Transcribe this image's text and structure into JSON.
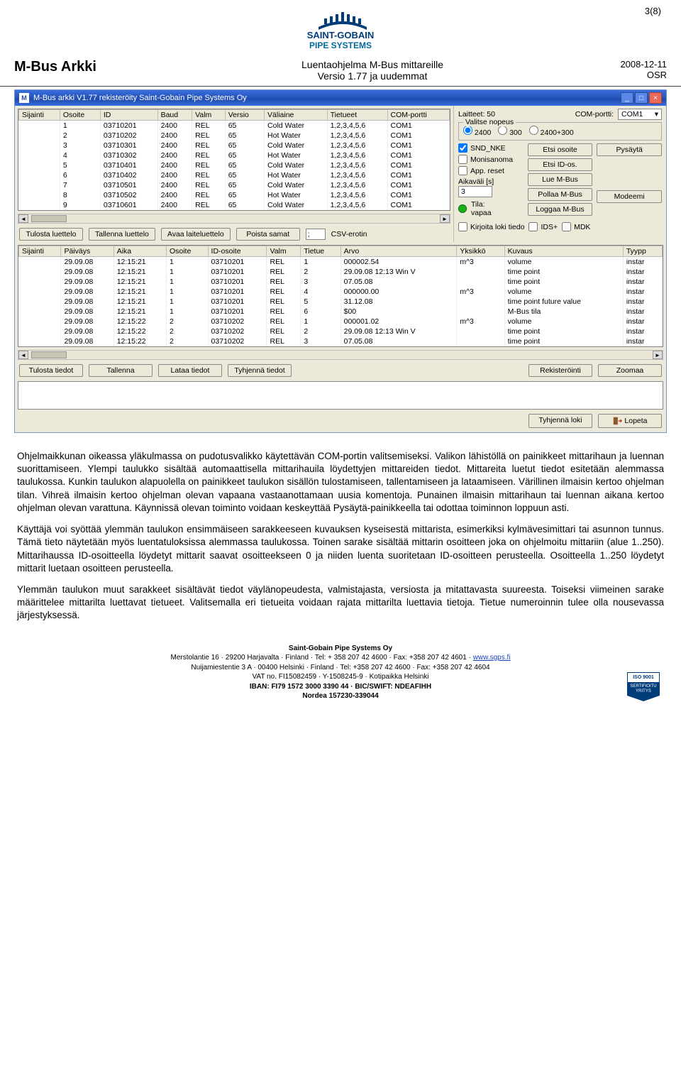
{
  "page": {
    "page_indicator": "3(8)",
    "product": "M-Bus Arkki",
    "subtitle_line1": "Luentaohjelma M-Bus mittareille",
    "subtitle_line2": "Versio 1.77 ja uudemmat",
    "date": "2008-12-11",
    "author": "OSR",
    "logo_brand": "SAINT-GOBAIN",
    "logo_sub": "PIPE SYSTEMS"
  },
  "window": {
    "title": "M-Bus arkki V1.77 rekisteröity  Saint-Gobain Pipe Systems Oy",
    "buttons": {
      "min": "_",
      "max": "□",
      "close": "×"
    },
    "table1": {
      "headers": [
        "Sijainti",
        "Osoite",
        "ID",
        "Baud",
        "Valm",
        "Versio",
        "Väliaine",
        "Tietueet",
        "COM-portti"
      ],
      "rows": [
        [
          "",
          "1",
          "03710201",
          "2400",
          "REL",
          "65",
          "Cold Water",
          "1,2,3,4,5,6",
          "COM1"
        ],
        [
          "",
          "2",
          "03710202",
          "2400",
          "REL",
          "65",
          "Hot Water",
          "1,2,3,4,5,6",
          "COM1"
        ],
        [
          "",
          "3",
          "03710301",
          "2400",
          "REL",
          "65",
          "Cold Water",
          "1,2,3,4,5,6",
          "COM1"
        ],
        [
          "",
          "4",
          "03710302",
          "2400",
          "REL",
          "65",
          "Hot Water",
          "1,2,3,4,5,6",
          "COM1"
        ],
        [
          "",
          "5",
          "03710401",
          "2400",
          "REL",
          "65",
          "Cold Water",
          "1,2,3,4,5,6",
          "COM1"
        ],
        [
          "",
          "6",
          "03710402",
          "2400",
          "REL",
          "65",
          "Hot Water",
          "1,2,3,4,5,6",
          "COM1"
        ],
        [
          "",
          "7",
          "03710501",
          "2400",
          "REL",
          "65",
          "Cold Water",
          "1,2,3,4,5,6",
          "COM1"
        ],
        [
          "",
          "8",
          "03710502",
          "2400",
          "REL",
          "65",
          "Hot Water",
          "1,2,3,4,5,6",
          "COM1"
        ],
        [
          "",
          "9",
          "03710601",
          "2400",
          "REL",
          "65",
          "Cold Water",
          "1,2,3,4,5,6",
          "COM1"
        ]
      ]
    },
    "btns1": {
      "print": "Tulosta luettelo",
      "save": "Tallenna luettelo",
      "open": "Avaa laiteluettelo",
      "remove": "Poista samat",
      "csv_label": "CSV-erotin",
      "csv_value": ";"
    },
    "table2": {
      "headers": [
        "Sijainti",
        "Päiväys",
        "Aika",
        "Osoite",
        "ID-osoite",
        "Valm",
        "Tietue",
        "Arvo",
        "Yksikkö",
        "Kuvaus",
        "Tyypp"
      ],
      "rows": [
        [
          "",
          "29.09.08",
          "12:15:21",
          "1",
          "03710201",
          "REL",
          "1",
          "000002.54",
          "m^3",
          "volume",
          "instar"
        ],
        [
          "",
          "29.09.08",
          "12:15:21",
          "1",
          "03710201",
          "REL",
          "2",
          "29.09.08 12:13 Win  V",
          "",
          "time point",
          "instar"
        ],
        [
          "",
          "29.09.08",
          "12:15:21",
          "1",
          "03710201",
          "REL",
          "3",
          "07.05.08",
          "",
          "time point",
          "instar"
        ],
        [
          "",
          "29.09.08",
          "12:15:21",
          "1",
          "03710201",
          "REL",
          "4",
          "000000.00",
          "m^3",
          "volume",
          "instar"
        ],
        [
          "",
          "29.09.08",
          "12:15:21",
          "1",
          "03710201",
          "REL",
          "5",
          "31.12.08",
          "",
          "time point future value",
          "instar"
        ],
        [
          "",
          "29.09.08",
          "12:15:21",
          "1",
          "03710201",
          "REL",
          "6",
          "$00",
          "",
          "M-Bus tila",
          "instar"
        ],
        [
          "",
          "29.09.08",
          "12:15:22",
          "2",
          "03710202",
          "REL",
          "1",
          "000001.02",
          "m^3",
          "volume",
          "instar"
        ],
        [
          "",
          "29.09.08",
          "12:15:22",
          "2",
          "03710202",
          "REL",
          "2",
          "29.09.08 12:13 Win  V",
          "",
          "time point",
          "instar"
        ],
        [
          "",
          "29.09.08",
          "12:15:22",
          "2",
          "03710202",
          "REL",
          "3",
          "07.05.08",
          "",
          "time point",
          "instar"
        ]
      ]
    },
    "btns2": {
      "print": "Tulosta tiedot",
      "save": "Tallenna",
      "load": "Lataa tiedot",
      "clear": "Tyhjennä tiedot",
      "register": "Rekisteröinti",
      "zoom": "Zoomaa"
    },
    "btns3": {
      "clearlog": "Tyhjennä loki",
      "quit": "Lopeta"
    },
    "panel": {
      "devices_label": "Laitteet: 50",
      "comport_label": "COM-portti:",
      "comport_value": "COM1",
      "speed_legend": "Valitse nopeus",
      "speed_opts": [
        "2400",
        "300",
        "2400+300"
      ],
      "chk_sndnke": "SND_NKE",
      "chk_monisanoma": "Monisanoma",
      "chk_appreset": "App. reset",
      "interval_label": "Aikaväli [s]",
      "interval_value": "3",
      "status_label": "Tila:",
      "status_value": "vapaa",
      "btn_find_addr": "Etsi osoite",
      "btn_find_id": "Etsi ID-os.",
      "btn_read": "Lue M-Bus",
      "btn_poll": "Pollaa M-Bus",
      "btn_log": "Loggaa M-Bus",
      "btn_stop": "Pysäytä",
      "btn_modem": "Modeemi",
      "chk_writelog": "Kirjoita loki tiedo",
      "chk_ids": "IDS+",
      "chk_mdk": "MDK"
    }
  },
  "body": {
    "p1": "Ohjelmaikkunan oikeassa yläkulmassa on pudotusvalikko käytettävän COM-portin valitsemiseksi. Valikon lähistöllä on painikkeet mittarihaun ja luennan suorittamiseen. Ylempi taulukko sisältää automaattisella mittarihauila löydettyjen mittareiden tiedot. Mittareita luetut tiedot esitetään alemmassa taulukossa. Kunkin taulukon alapuolella on painikkeet taulukon sisällön tulostamiseen, tallentamiseen ja lataamiseen. Värillinen ilmaisin kertoo ohjelman tilan. Vihreä ilmaisin kertoo ohjelman olevan vapaana vastaanottamaan uusia komentoja. Punainen ilmaisin mittarihaun tai luennan aikana kertoo ohjelman olevan varattuna. Käynnissä olevan toiminto voidaan keskeyttää Pysäytä-painikkeella tai odottaa toiminnon loppuun asti.",
    "p2": "Käyttäjä voi syöttää ylemmän taulukon ensimmäiseen sarakkeeseen kuvauksen kyseisestä mittarista, esimerkiksi kylmävesimittari tai asunnon tunnus. Tämä tieto näytetään myös luentatuloksissa alemmassa taulukossa. Toinen sarake sisältää mittarin osoitteen joka on ohjelmoitu mittariin (alue 1..250). Mittarihaussa ID-osoitteella löydetyt mittarit saavat osoitteekseen 0 ja niiden luenta suoritetaan ID-osoitteen perusteella. Osoitteella 1..250 löydetyt mittarit luetaan osoitteen perusteella.",
    "p3": "Ylemmän taulukon muut sarakkeet sisältävät tiedot väylänopeudesta, valmistajasta, versiosta ja mitattavasta suureesta. Toiseksi viimeinen sarake määrittelee mittarilta luettavat tietueet. Valitsemalla eri tietueita voidaan rajata mittarilta luettavia tietoja. Tietue numeroinnin tulee olla nousevassa järjestyksessä."
  },
  "footer": {
    "company_bold": "Saint-Gobain Pipe Systems Oy",
    "line1_a": "Merstolantie 16 · 29200 Harjavalta · Finland · Tel: + 358 207 42 4600 · Fax: +358 207 42 4601 · ",
    "line1_link": "www.sgps.fi",
    "line2": "Nuijamiestentie 3 A · 00400 Helsinki · Finland · Tel: +358 207 42 4600 · Fax: +358 207 42 4604",
    "line3": "VAT no. FI15082459 · Y-1508245-9 · Kotipaikka Helsinki",
    "line4": "IBAN: FI79 1572 3000 3390 44 · BIC/SWIFT: NDEAFIHH",
    "line5": "Nordea 157230-339044",
    "iso_top": "ISO 9001",
    "iso_bot": "SERTIFIOITU\nYRITYS"
  }
}
